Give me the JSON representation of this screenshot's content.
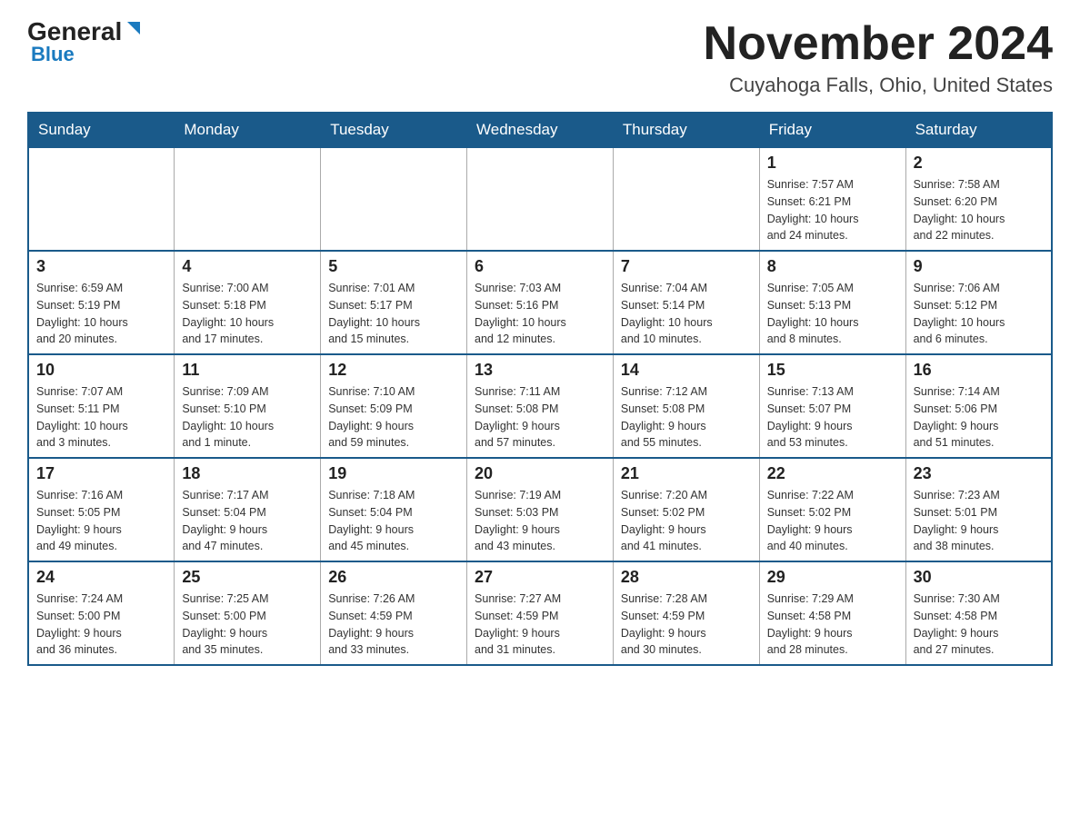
{
  "logo": {
    "general": "General",
    "blue": "Blue"
  },
  "title": "November 2024",
  "subtitle": "Cuyahoga Falls, Ohio, United States",
  "weekdays": [
    "Sunday",
    "Monday",
    "Tuesday",
    "Wednesday",
    "Thursday",
    "Friday",
    "Saturday"
  ],
  "weeks": [
    [
      {
        "day": "",
        "info": ""
      },
      {
        "day": "",
        "info": ""
      },
      {
        "day": "",
        "info": ""
      },
      {
        "day": "",
        "info": ""
      },
      {
        "day": "",
        "info": ""
      },
      {
        "day": "1",
        "info": "Sunrise: 7:57 AM\nSunset: 6:21 PM\nDaylight: 10 hours\nand 24 minutes."
      },
      {
        "day": "2",
        "info": "Sunrise: 7:58 AM\nSunset: 6:20 PM\nDaylight: 10 hours\nand 22 minutes."
      }
    ],
    [
      {
        "day": "3",
        "info": "Sunrise: 6:59 AM\nSunset: 5:19 PM\nDaylight: 10 hours\nand 20 minutes."
      },
      {
        "day": "4",
        "info": "Sunrise: 7:00 AM\nSunset: 5:18 PM\nDaylight: 10 hours\nand 17 minutes."
      },
      {
        "day": "5",
        "info": "Sunrise: 7:01 AM\nSunset: 5:17 PM\nDaylight: 10 hours\nand 15 minutes."
      },
      {
        "day": "6",
        "info": "Sunrise: 7:03 AM\nSunset: 5:16 PM\nDaylight: 10 hours\nand 12 minutes."
      },
      {
        "day": "7",
        "info": "Sunrise: 7:04 AM\nSunset: 5:14 PM\nDaylight: 10 hours\nand 10 minutes."
      },
      {
        "day": "8",
        "info": "Sunrise: 7:05 AM\nSunset: 5:13 PM\nDaylight: 10 hours\nand 8 minutes."
      },
      {
        "day": "9",
        "info": "Sunrise: 7:06 AM\nSunset: 5:12 PM\nDaylight: 10 hours\nand 6 minutes."
      }
    ],
    [
      {
        "day": "10",
        "info": "Sunrise: 7:07 AM\nSunset: 5:11 PM\nDaylight: 10 hours\nand 3 minutes."
      },
      {
        "day": "11",
        "info": "Sunrise: 7:09 AM\nSunset: 5:10 PM\nDaylight: 10 hours\nand 1 minute."
      },
      {
        "day": "12",
        "info": "Sunrise: 7:10 AM\nSunset: 5:09 PM\nDaylight: 9 hours\nand 59 minutes."
      },
      {
        "day": "13",
        "info": "Sunrise: 7:11 AM\nSunset: 5:08 PM\nDaylight: 9 hours\nand 57 minutes."
      },
      {
        "day": "14",
        "info": "Sunrise: 7:12 AM\nSunset: 5:08 PM\nDaylight: 9 hours\nand 55 minutes."
      },
      {
        "day": "15",
        "info": "Sunrise: 7:13 AM\nSunset: 5:07 PM\nDaylight: 9 hours\nand 53 minutes."
      },
      {
        "day": "16",
        "info": "Sunrise: 7:14 AM\nSunset: 5:06 PM\nDaylight: 9 hours\nand 51 minutes."
      }
    ],
    [
      {
        "day": "17",
        "info": "Sunrise: 7:16 AM\nSunset: 5:05 PM\nDaylight: 9 hours\nand 49 minutes."
      },
      {
        "day": "18",
        "info": "Sunrise: 7:17 AM\nSunset: 5:04 PM\nDaylight: 9 hours\nand 47 minutes."
      },
      {
        "day": "19",
        "info": "Sunrise: 7:18 AM\nSunset: 5:04 PM\nDaylight: 9 hours\nand 45 minutes."
      },
      {
        "day": "20",
        "info": "Sunrise: 7:19 AM\nSunset: 5:03 PM\nDaylight: 9 hours\nand 43 minutes."
      },
      {
        "day": "21",
        "info": "Sunrise: 7:20 AM\nSunset: 5:02 PM\nDaylight: 9 hours\nand 41 minutes."
      },
      {
        "day": "22",
        "info": "Sunrise: 7:22 AM\nSunset: 5:02 PM\nDaylight: 9 hours\nand 40 minutes."
      },
      {
        "day": "23",
        "info": "Sunrise: 7:23 AM\nSunset: 5:01 PM\nDaylight: 9 hours\nand 38 minutes."
      }
    ],
    [
      {
        "day": "24",
        "info": "Sunrise: 7:24 AM\nSunset: 5:00 PM\nDaylight: 9 hours\nand 36 minutes."
      },
      {
        "day": "25",
        "info": "Sunrise: 7:25 AM\nSunset: 5:00 PM\nDaylight: 9 hours\nand 35 minutes."
      },
      {
        "day": "26",
        "info": "Sunrise: 7:26 AM\nSunset: 4:59 PM\nDaylight: 9 hours\nand 33 minutes."
      },
      {
        "day": "27",
        "info": "Sunrise: 7:27 AM\nSunset: 4:59 PM\nDaylight: 9 hours\nand 31 minutes."
      },
      {
        "day": "28",
        "info": "Sunrise: 7:28 AM\nSunset: 4:59 PM\nDaylight: 9 hours\nand 30 minutes."
      },
      {
        "day": "29",
        "info": "Sunrise: 7:29 AM\nSunset: 4:58 PM\nDaylight: 9 hours\nand 28 minutes."
      },
      {
        "day": "30",
        "info": "Sunrise: 7:30 AM\nSunset: 4:58 PM\nDaylight: 9 hours\nand 27 minutes."
      }
    ]
  ]
}
